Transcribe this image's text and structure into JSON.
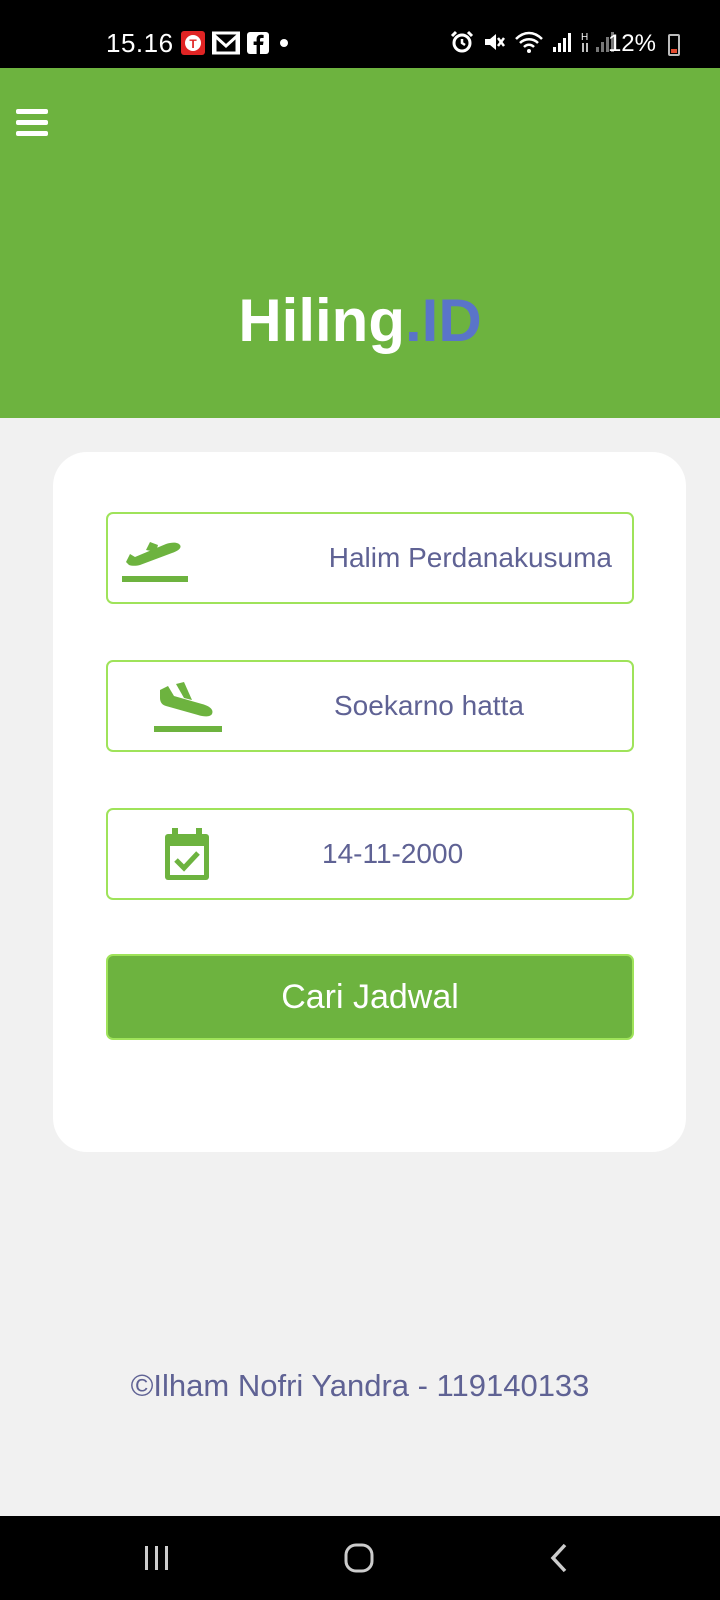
{
  "status_bar": {
    "time": "15.16",
    "battery": "12%"
  },
  "header": {
    "logo_main": "Hiling",
    "logo_accent": ".ID",
    "colors": {
      "header_bg": "#6db33f",
      "logo_accent": "#5a74c9"
    }
  },
  "form": {
    "from_airport": "Halim Perdanakusuma",
    "to_airport": "Soekarno hatta",
    "date": "14-11-2000",
    "search_label": "Cari Jadwal",
    "icons": [
      "plane-takeoff-icon",
      "plane-landing-icon",
      "calendar-check-icon"
    ]
  },
  "footer": {
    "credit": "©Ilham Nofri Yandra - 119140133"
  },
  "nav": {
    "icons": [
      "recent-apps-icon",
      "home-icon",
      "back-icon"
    ]
  }
}
